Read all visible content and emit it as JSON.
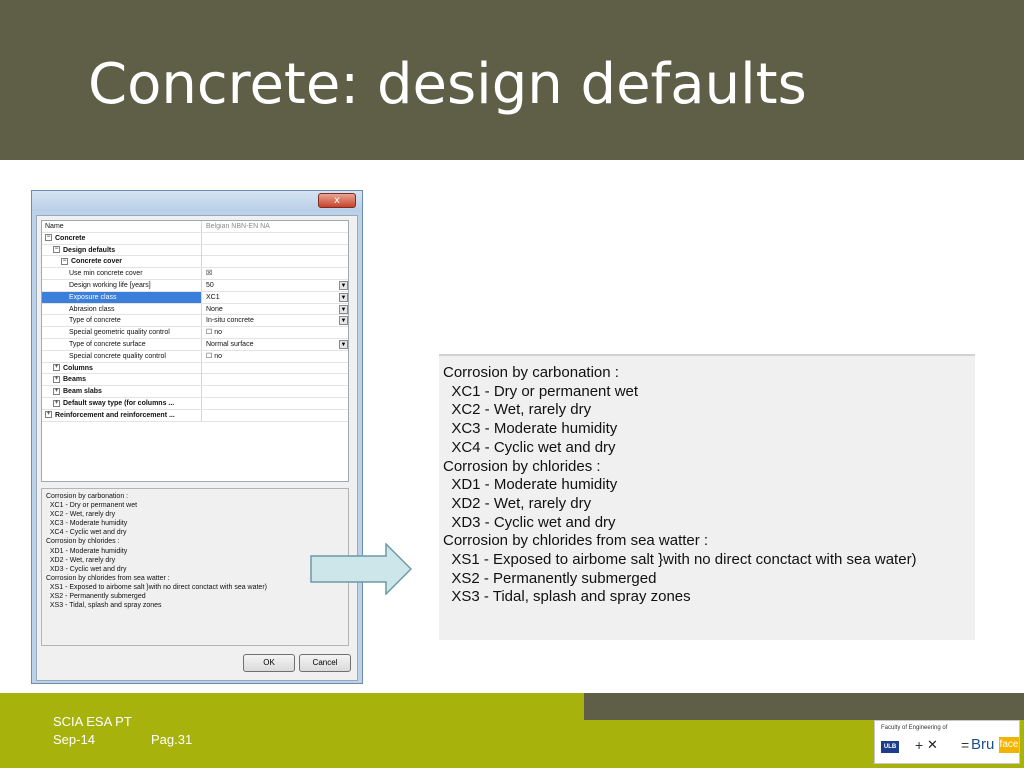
{
  "slide": {
    "title": "Concrete: design defaults"
  },
  "dialog": {
    "close_label": "x",
    "grid": {
      "header": {
        "name": "Name",
        "value": "Belgian NBN-EN NA"
      },
      "rows": [
        {
          "label": "Concrete",
          "value": "",
          "indent": 0,
          "expander": "−",
          "bold": true
        },
        {
          "label": "Design defaults",
          "value": "",
          "indent": 1,
          "expander": "−",
          "bold": true
        },
        {
          "label": "Concrete cover",
          "value": "",
          "indent": 2,
          "expander": "−",
          "bold": true
        },
        {
          "label": "Use min concrete cover",
          "value": "☒",
          "indent": 3,
          "expander": "",
          "bold": false
        },
        {
          "label": "Design working life [years]",
          "value": "50",
          "indent": 3,
          "expander": "",
          "bold": false,
          "dropdown": true
        },
        {
          "label": "Exposure class",
          "value": "XC1",
          "indent": 3,
          "expander": "",
          "bold": false,
          "dropdown": true,
          "selected": true
        },
        {
          "label": "Abrasion class",
          "value": "None",
          "indent": 3,
          "expander": "",
          "bold": false,
          "dropdown": true
        },
        {
          "label": "Type of concrete",
          "value": "In-situ concrete",
          "indent": 3,
          "expander": "",
          "bold": false,
          "dropdown": true
        },
        {
          "label": "Special geometric quality control",
          "value": "☐ no",
          "indent": 3,
          "expander": "",
          "bold": false
        },
        {
          "label": "Type of concrete surface",
          "value": "Normal surface",
          "indent": 3,
          "expander": "",
          "bold": false,
          "dropdown": true
        },
        {
          "label": "Special concrete quality control",
          "value": "☐ no",
          "indent": 3,
          "expander": "",
          "bold": false
        },
        {
          "label": "Columns",
          "value": "",
          "indent": 1,
          "expander": "+",
          "bold": true
        },
        {
          "label": "Beams",
          "value": "",
          "indent": 1,
          "expander": "+",
          "bold": true
        },
        {
          "label": "Beam slabs",
          "value": "",
          "indent": 1,
          "expander": "+",
          "bold": true
        },
        {
          "label": "Default sway type (for columns ...",
          "value": "",
          "indent": 1,
          "expander": "+",
          "bold": true
        },
        {
          "label": "Reinforcement and reinforcement ...",
          "value": "",
          "indent": 0,
          "expander": "+",
          "bold": true
        }
      ]
    },
    "description_lines": [
      "Corrosion by carbonation :",
      "  XC1 - Dry or permanent wet",
      "  XC2 - Wet, rarely dry",
      "  XC3 - Moderate humidity",
      "  XC4 - Cyclic wet and dry",
      "Corrosion by chlorides :",
      "  XD1 - Moderate humidity",
      "  XD2 - Wet, rarely dry",
      "  XD3 - Cyclic wet and dry",
      "Corrosion by chlorides from sea watter :",
      "  XS1 - Exposed to airbome salt }with no direct conctact with sea water)",
      "  XS2 - Permanently submerged",
      "  XS3 - Tidal, splash and spray zones"
    ],
    "ok_label": "OK",
    "cancel_label": "Cancel"
  },
  "enlarged": {
    "lines": [
      "Corrosion by carbonation :",
      "  XC1 - Dry or permanent wet",
      "  XC2 - Wet, rarely dry",
      "  XC3 - Moderate humidity",
      "  XC4 - Cyclic wet and dry",
      "Corrosion by chlorides :",
      "  XD1 - Moderate humidity",
      "  XD2 - Wet, rarely dry",
      "  XD3 - Cyclic wet and dry",
      "Corrosion by chlorides from sea watter :",
      "  XS1 - Exposed to airbome salt }with no direct conctact with sea water)",
      "  XS2 - Permanently submerged",
      "  XS3 - Tidal, splash and spray zones"
    ]
  },
  "footer": {
    "company": "SCIA ESA PT",
    "date": "Sep-14",
    "page": "Pag.31",
    "logo": {
      "faculty": "Faculty of Engineering of",
      "ulb": "ULB",
      "plus": "+",
      "equals": "=",
      "bru": "Bru",
      "face": "face"
    }
  },
  "colors": {
    "title_band": "#5f5e46",
    "footer_green": "#a7b30c",
    "selection": "#3b7fdb"
  }
}
